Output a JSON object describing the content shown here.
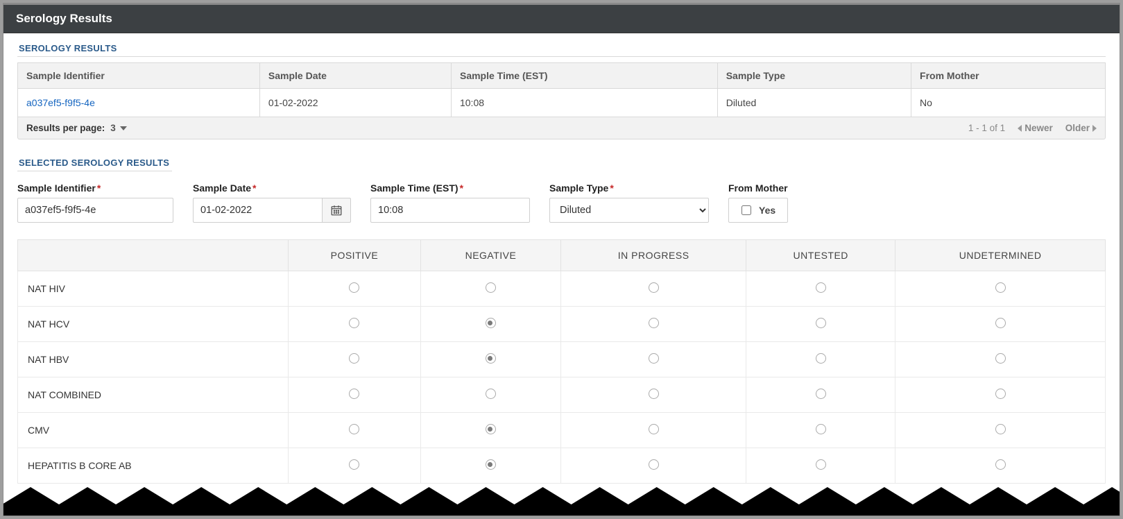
{
  "header": {
    "title": "Serology Results"
  },
  "sections": {
    "results_title": "SEROLOGY RESULTS",
    "selected_title": "SELECTED SEROLOGY RESULTS"
  },
  "grid": {
    "headers": {
      "sample_id": "Sample Identifier",
      "sample_date": "Sample Date",
      "sample_time": "Sample Time (EST)",
      "sample_type": "Sample Type",
      "from_mother": "From Mother"
    },
    "rows": [
      {
        "sample_id": "a037ef5-f9f5-4e",
        "sample_date": "01-02-2022",
        "sample_time": "10:08",
        "sample_type": "Diluted",
        "from_mother": "No"
      }
    ]
  },
  "pager": {
    "rpp_label": "Results per page:",
    "rpp_value": "3",
    "range": "1 - 1 of 1",
    "newer": "Newer",
    "older": "Older"
  },
  "form": {
    "labels": {
      "sample_id": "Sample Identifier",
      "sample_date": "Sample Date",
      "sample_time": "Sample Time (EST)",
      "sample_type": "Sample Type",
      "from_mother": "From Mother",
      "yes": "Yes"
    },
    "values": {
      "sample_id": "a037ef5-f9f5-4e",
      "sample_date": "01-02-2022",
      "sample_time": "10:08",
      "sample_type": "Diluted"
    }
  },
  "results": {
    "columns": [
      "POSITIVE",
      "NEGATIVE",
      "IN PROGRESS",
      "UNTESTED",
      "UNDETERMINED"
    ],
    "tests": [
      {
        "name": "NAT HIV",
        "selected": null
      },
      {
        "name": "NAT HCV",
        "selected": 1
      },
      {
        "name": "NAT HBV",
        "selected": 1
      },
      {
        "name": "NAT COMBINED",
        "selected": null
      },
      {
        "name": "CMV",
        "selected": 1
      },
      {
        "name": "HEPATITIS B CORE AB",
        "selected": 1
      }
    ]
  }
}
